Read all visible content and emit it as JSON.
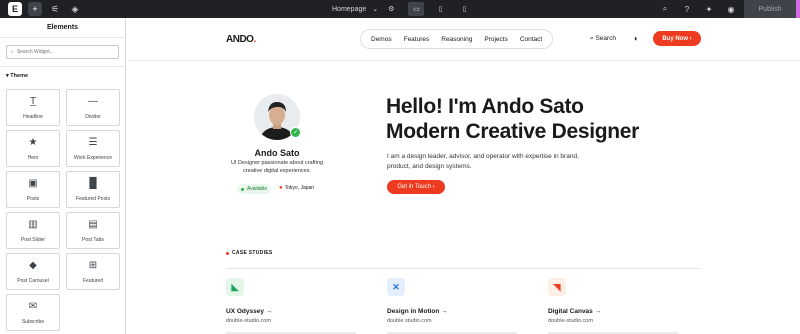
{
  "topbar": {
    "page_name": "Homepage",
    "publish_label": "Publish"
  },
  "panel": {
    "title": "Elements",
    "search_placeholder": "Search Widget...",
    "section_label": "Theme",
    "tiles": [
      {
        "label": "Headline",
        "icon": "headline-icon",
        "glyph": "T̲"
      },
      {
        "label": "Divider",
        "icon": "divider-icon",
        "glyph": "—"
      },
      {
        "label": "Hero",
        "icon": "hero-icon",
        "glyph": "★"
      },
      {
        "label": "Work Experience",
        "icon": "list-icon",
        "glyph": "☰"
      },
      {
        "label": "Posts",
        "icon": "image-icon",
        "glyph": "▣"
      },
      {
        "label": "Featured Posts",
        "icon": "columns-icon",
        "glyph": "▐▌"
      },
      {
        "label": "Post Slider",
        "icon": "slider-icon",
        "glyph": "▥"
      },
      {
        "label": "Post Tabs",
        "icon": "tabs-icon",
        "glyph": "▤"
      },
      {
        "label": "Post Carousel",
        "icon": "carousel-icon",
        "glyph": "◆"
      },
      {
        "label": "Featured",
        "icon": "grid-plus-icon",
        "glyph": "⊞"
      },
      {
        "label": "Subscribe",
        "icon": "mail-icon",
        "glyph": "✉"
      }
    ]
  },
  "site": {
    "logo_text": "ANDO",
    "logo_dot": ".",
    "nav": [
      "Demos",
      "Features",
      "Reasoning",
      "Projects",
      "Contact"
    ],
    "search_label": "Search",
    "buy_label": "Buy Now",
    "profile": {
      "name": "Ando Sato",
      "description": "UI Designer passionate about crafting creative digital experiences.",
      "available": "Available",
      "location": "Tokyo, Japan"
    },
    "headline_line1": "Hello! I'm Ando Sato",
    "headline_line2": "Modern Creative Designer",
    "intro": "I am a design leader, advisor, and operator with expertise in brand, product, and design systems.",
    "cta": "Get in Touch",
    "case_label": "CASE STUDIES",
    "cases": [
      {
        "title": "UX Odyssey",
        "sub": "double-studio.com",
        "color": "#e3f6ea",
        "fg": "#22a559"
      },
      {
        "title": "Design in Motion",
        "sub": "double studio.com",
        "color": "#e5eefc",
        "fg": "#2f6fe0"
      },
      {
        "title": "Digital Canvas",
        "sub": "double-studio.com",
        "color": "#fdeee6",
        "fg": "#ee3b1f"
      }
    ]
  }
}
